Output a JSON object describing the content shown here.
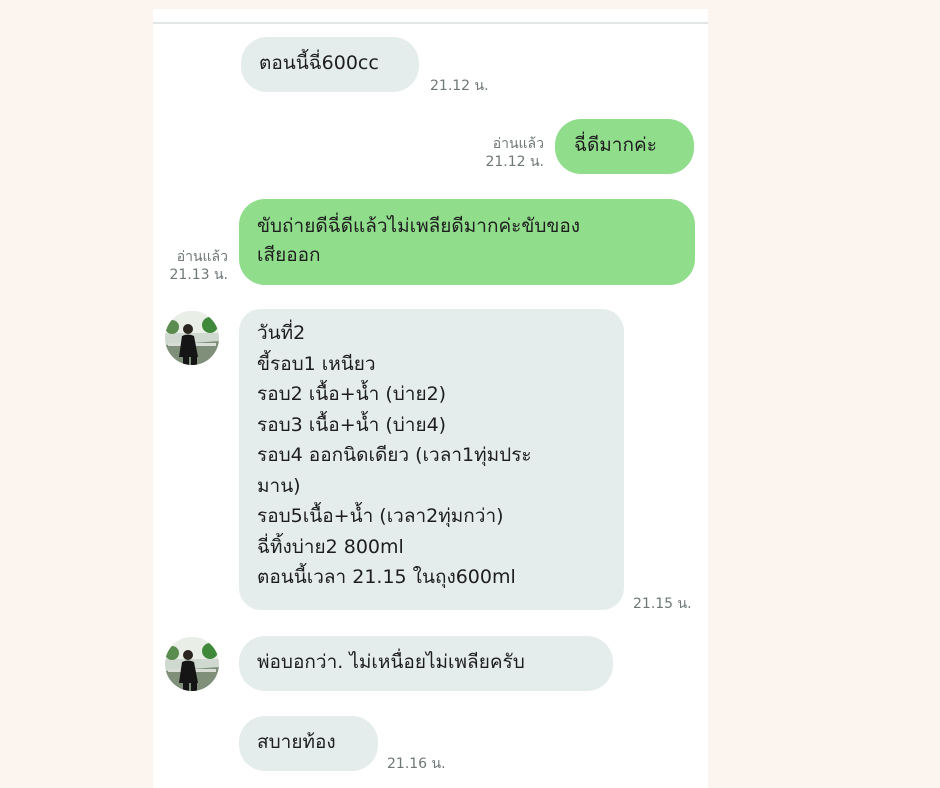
{
  "messages": {
    "m1": {
      "text": "ตอนนี้ฉี่600cc",
      "time": "21.12 น."
    },
    "m2": {
      "text": "ฉี่ดีมากค่ะ",
      "read": "อ่านแล้ว",
      "time": "21.12 น."
    },
    "m3": {
      "text": "ขับถ่ายดีฉี่ดีแล้วไม่เพลียดีมากค่ะขับของ\nเสียออก",
      "read": "อ่านแล้ว",
      "time": "21.13 น."
    },
    "m4": {
      "text": "วันที่2\nขี้รอบ1 เหนียว\nรอบ2 เนื้อ+น้ำ (บ่าย2)\nรอบ3 เนื้อ+น้ำ (บ่าย4)\nรอบ4 ออกนิดเดียว (เวลา1ทุ่มประ\nมาน)\nรอบ5เนื้อ+น้ำ (เวลา2ทุ่มกว่า)\nฉี่ทิ้งบ่าย2 800ml\nตอนนี้เวลา 21.15 ในถุง600ml",
      "time": "21.15 น."
    },
    "m5": {
      "text": "พ่อบอกว่า. ไม่เหนื่อยไม่เพลียครับ"
    },
    "m6": {
      "text": "สบายท้อง",
      "time": "21.16 น."
    }
  },
  "colors": {
    "page_background": "#fcf4ef",
    "panel_background": "#ffffff",
    "incoming_bubble": "#e5ecec",
    "outgoing_bubble": "#90dd8c",
    "timestamp_text": "#6f7777"
  },
  "icons": {
    "avatar": "contact-profile-photo"
  }
}
